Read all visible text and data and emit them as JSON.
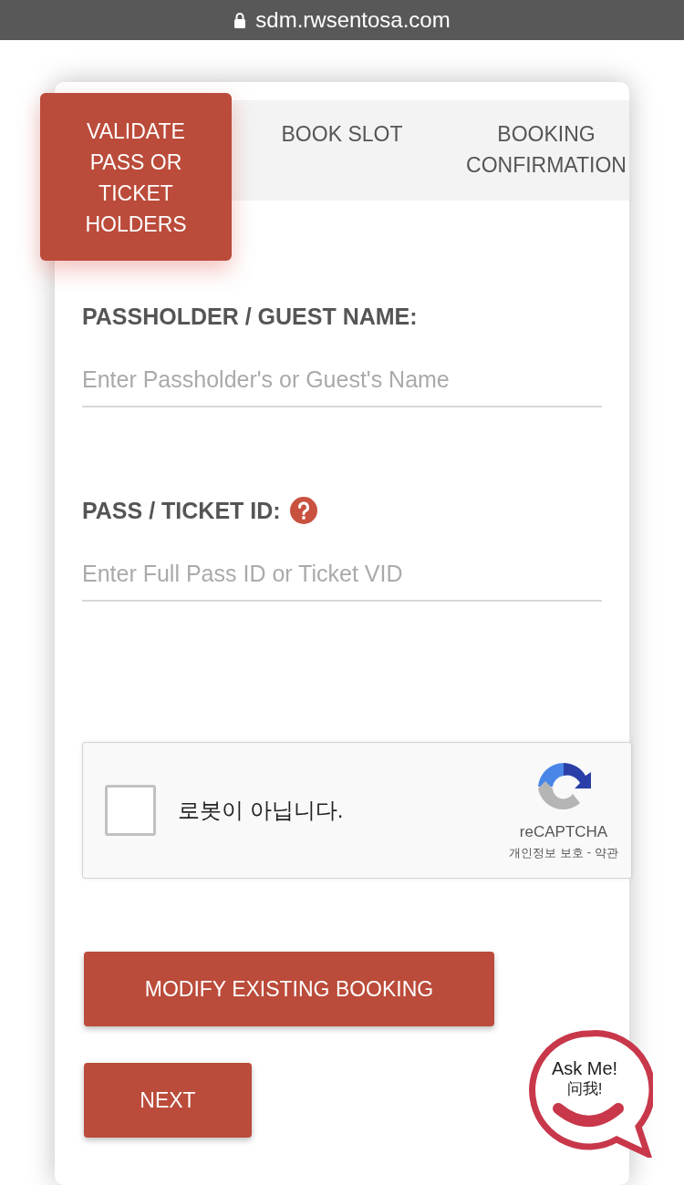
{
  "address_bar": {
    "url": "sdm.rwsentosa.com"
  },
  "tabs": [
    {
      "label": "VALIDATE PASS OR TICKET HOLDERS",
      "selected": true
    },
    {
      "label": "BOOK SLOT",
      "selected": false
    },
    {
      "label": "BOOKING CONFIRMATION",
      "selected": false
    }
  ],
  "fields": [
    {
      "label": "PASSHOLDER / GUEST NAME:",
      "placeholder": "Enter Passholder's or Guest's Name",
      "help": false
    },
    {
      "label": "PASS / TICKET ID:",
      "placeholder": "Enter Full Pass ID or Ticket VID",
      "help": true
    }
  ],
  "captcha": {
    "label": "로봇이 아닙니다.",
    "checked": false,
    "brand": "reCAPTCHA",
    "links": [
      "개인정보 보호",
      "-",
      "약관"
    ]
  },
  "buttons": [
    "MODIFY EXISTING BOOKING",
    "NEXT"
  ],
  "chat_widget": {
    "title": "Ask Me!",
    "subtitle": "问我!"
  }
}
